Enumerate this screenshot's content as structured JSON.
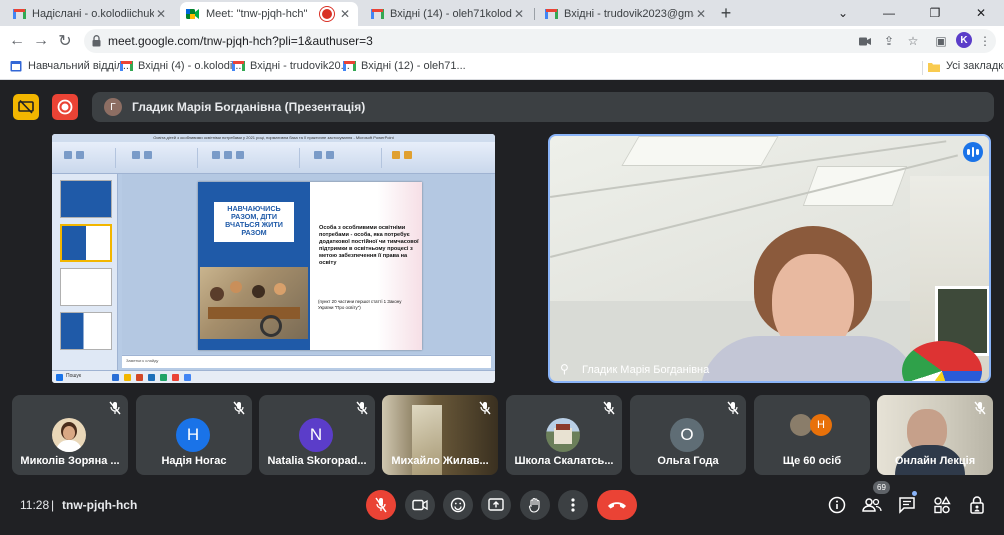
{
  "browser": {
    "tabs": [
      {
        "title": "Надіслані - o.kolodiichuk@ippo.ku",
        "icon": "gmail-icon",
        "active": false
      },
      {
        "title": "Meet: \"tnw-pjqh-hch\"",
        "icon": "meet-icon",
        "active": true,
        "recording": true
      },
      {
        "title": "Вхідні (14) - oleh71kolod@gmail.c",
        "icon": "gmail-icon",
        "active": false
      },
      {
        "title": "Вхідні - trudovik2023@gmail.com",
        "icon": "gmail-icon",
        "active": false
      }
    ],
    "new_tab": "+",
    "url": "meet.google.com/tnw-pjqh-hch?pli=1&authuser=3",
    "profile_initial": "K",
    "bookmarks": [
      {
        "label": "Навчальний відділ...",
        "icon": "calendar-icon"
      },
      {
        "label": "Вхідні (4) - o.kolodi...",
        "icon": "gmail-icon"
      },
      {
        "label": "Вхідні - trudovik20...",
        "icon": "gmail-icon"
      },
      {
        "label": "Вхідні (12) - oleh71...",
        "icon": "gmail-icon"
      }
    ],
    "all_bookmarks": "Усі закладки"
  },
  "meet": {
    "presenter": {
      "initial": "Г",
      "label": "Гладик Марія Богданівна (Презентація)"
    },
    "presentation": {
      "window_title": "Освіта дітей з особливими освітніми потребами у 2021 році, нормативна база та її практичне застосування - Microsoft PowerPoint",
      "slide_box_text": "НАВЧАЮЧИСЬ РАЗОМ, ДІТИ ВЧАТЬСЯ ЖИТИ РАЗОМ",
      "slide_main_text": "Особа з особливими освітніми потребами - особа, яка потребує додаткової постійної чи тимчасової підтримки в освітньому процесі з метою забезпечення її права на освіту",
      "slide_ref_text": "(пункт 20 частини першої статті 1 Закону України \"Про освіту\")",
      "notes_placeholder": "Заметки к слайду",
      "taskbar_search": "Пошук"
    },
    "camera": {
      "name": "Гладик Марія Богданівна"
    },
    "participants": [
      {
        "name": "Миколів Зоряна ...",
        "type": "photo",
        "color": "#c9a27a"
      },
      {
        "name": "Надія Ногас",
        "type": "initial",
        "initial": "Н",
        "color": "#1a73e8"
      },
      {
        "name": "Natalia Skoropad...",
        "type": "initial",
        "initial": "N",
        "color": "#5b3dc9"
      },
      {
        "name": "Михайло Жилав...",
        "type": "video",
        "color": "#6b5a3a"
      },
      {
        "name": "Школа Скалатсь...",
        "type": "photo",
        "color": "#6b7f5a"
      },
      {
        "name": "Ольга Года",
        "type": "initial",
        "initial": "О",
        "color": "#5f6d75"
      },
      {
        "name": "Ще 60 осіб",
        "type": "more",
        "initial": "Н",
        "color": "#e8710a"
      },
      {
        "name": "Онлайн Лекція",
        "type": "video",
        "color": "#d8d4c8"
      }
    ],
    "bottom": {
      "time": "11:28",
      "separator": "|",
      "meeting_code": "tnw-pjqh-hch",
      "participants_count": "69"
    }
  },
  "colors": {
    "accent": "#8ab4f8",
    "danger": "#ea4335",
    "warning": "#f2b600",
    "bg": "#202124",
    "tile": "#3c4043"
  }
}
